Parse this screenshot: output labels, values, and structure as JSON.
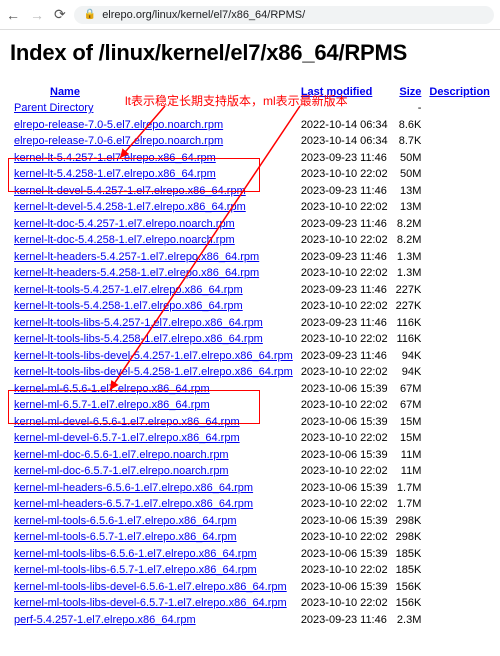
{
  "browser": {
    "url": "elrepo.org/linux/kernel/el7/x86_64/RPMS/"
  },
  "page": {
    "heading": "Index of /linux/kernel/el7/x86_64/RPMS"
  },
  "annotations": {
    "lt_text": "lt表示稳定长期支持版本，",
    "ml_text": "ml表示最新版本"
  },
  "headers": {
    "name": "Name",
    "last_modified": "Last modified",
    "size": "Size",
    "description": "Description"
  },
  "rows": [
    {
      "name": "Parent Directory",
      "modified": "",
      "size": "-"
    },
    {
      "name": "elrepo-release-7.0-5.el7.elrepo.noarch.rpm",
      "modified": "2022-10-14 06:34",
      "size": "8.6K"
    },
    {
      "name": "elrepo-release-7.0-6.el7.elrepo.noarch.rpm",
      "modified": "2023-10-14 06:34",
      "size": "8.7K"
    },
    {
      "name": "kernel-lt-5.4.257-1.el7.elrepo.x86_64.rpm",
      "modified": "2023-09-23 11:46",
      "size": "50M"
    },
    {
      "name": "kernel-lt-5.4.258-1.el7.elrepo.x86_64.rpm",
      "modified": "2023-10-10 22:02",
      "size": "50M"
    },
    {
      "name": "kernel-lt-devel-5.4.257-1.el7.elrepo.x86_64.rpm",
      "modified": "2023-09-23 11:46",
      "size": "13M"
    },
    {
      "name": "kernel-lt-devel-5.4.258-1.el7.elrepo.x86_64.rpm",
      "modified": "2023-10-10 22:02",
      "size": "13M"
    },
    {
      "name": "kernel-lt-doc-5.4.257-1.el7.elrepo.noarch.rpm",
      "modified": "2023-09-23 11:46",
      "size": "8.2M"
    },
    {
      "name": "kernel-lt-doc-5.4.258-1.el7.elrepo.noarch.rpm",
      "modified": "2023-10-10 22:02",
      "size": "8.2M"
    },
    {
      "name": "kernel-lt-headers-5.4.257-1.el7.elrepo.x86_64.rpm",
      "modified": "2023-09-23 11:46",
      "size": "1.3M"
    },
    {
      "name": "kernel-lt-headers-5.4.258-1.el7.elrepo.x86_64.rpm",
      "modified": "2023-10-10 22:02",
      "size": "1.3M"
    },
    {
      "name": "kernel-lt-tools-5.4.257-1.el7.elrepo.x86_64.rpm",
      "modified": "2023-09-23 11:46",
      "size": "227K"
    },
    {
      "name": "kernel-lt-tools-5.4.258-1.el7.elrepo.x86_64.rpm",
      "modified": "2023-10-10 22:02",
      "size": "227K"
    },
    {
      "name": "kernel-lt-tools-libs-5.4.257-1.el7.elrepo.x86_64.rpm",
      "modified": "2023-09-23 11:46",
      "size": "116K"
    },
    {
      "name": "kernel-lt-tools-libs-5.4.258-1.el7.elrepo.x86_64.rpm",
      "modified": "2023-10-10 22:02",
      "size": "116K"
    },
    {
      "name": "kernel-lt-tools-libs-devel-5.4.257-1.el7.elrepo.x86_64.rpm",
      "modified": "2023-09-23 11:46",
      "size": "94K"
    },
    {
      "name": "kernel-lt-tools-libs-devel-5.4.258-1.el7.elrepo.x86_64.rpm",
      "modified": "2023-10-10 22:02",
      "size": "94K"
    },
    {
      "name": "kernel-ml-6.5.6-1.el7.elrepo.x86_64.rpm",
      "modified": "2023-10-06 15:39",
      "size": "67M"
    },
    {
      "name": "kernel-ml-6.5.7-1.el7.elrepo.x86_64.rpm",
      "modified": "2023-10-10 22:02",
      "size": "67M"
    },
    {
      "name": "kernel-ml-devel-6.5.6-1.el7.elrepo.x86_64.rpm",
      "modified": "2023-10-06 15:39",
      "size": "15M"
    },
    {
      "name": "kernel-ml-devel-6.5.7-1.el7.elrepo.x86_64.rpm",
      "modified": "2023-10-10 22:02",
      "size": "15M"
    },
    {
      "name": "kernel-ml-doc-6.5.6-1.el7.elrepo.noarch.rpm",
      "modified": "2023-10-06 15:39",
      "size": "11M"
    },
    {
      "name": "kernel-ml-doc-6.5.7-1.el7.elrepo.noarch.rpm",
      "modified": "2023-10-10 22:02",
      "size": "11M"
    },
    {
      "name": "kernel-ml-headers-6.5.6-1.el7.elrepo.x86_64.rpm",
      "modified": "2023-10-06 15:39",
      "size": "1.7M"
    },
    {
      "name": "kernel-ml-headers-6.5.7-1.el7.elrepo.x86_64.rpm",
      "modified": "2023-10-10 22:02",
      "size": "1.7M"
    },
    {
      "name": "kernel-ml-tools-6.5.6-1.el7.elrepo.x86_64.rpm",
      "modified": "2023-10-06 15:39",
      "size": "298K"
    },
    {
      "name": "kernel-ml-tools-6.5.7-1.el7.elrepo.x86_64.rpm",
      "modified": "2023-10-10 22:02",
      "size": "298K"
    },
    {
      "name": "kernel-ml-tools-libs-6.5.6-1.el7.elrepo.x86_64.rpm",
      "modified": "2023-10-06 15:39",
      "size": "185K"
    },
    {
      "name": "kernel-ml-tools-libs-6.5.7-1.el7.elrepo.x86_64.rpm",
      "modified": "2023-10-10 22:02",
      "size": "185K"
    },
    {
      "name": "kernel-ml-tools-libs-devel-6.5.6-1.el7.elrepo.x86_64.rpm",
      "modified": "2023-10-06 15:39",
      "size": "156K"
    },
    {
      "name": "kernel-ml-tools-libs-devel-6.5.7-1.el7.elrepo.x86_64.rpm",
      "modified": "2023-10-10 22:02",
      "size": "156K"
    },
    {
      "name": "perf-5.4.257-1.el7.elrepo.x86_64.rpm",
      "modified": "2023-09-23 11:46",
      "size": "2.3M"
    }
  ]
}
